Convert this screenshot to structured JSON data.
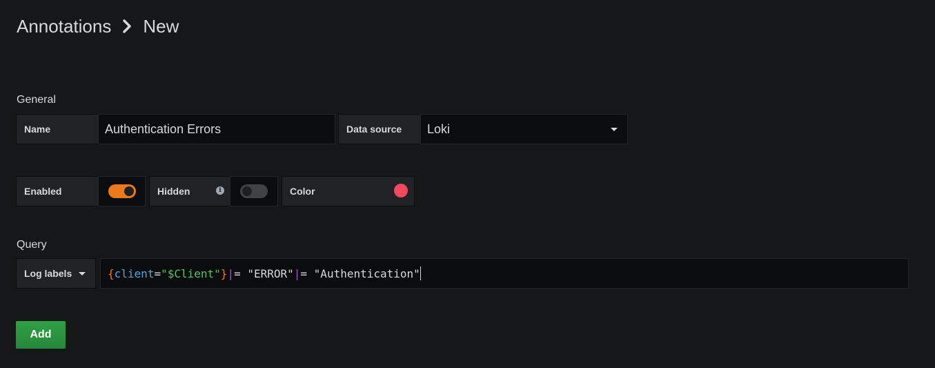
{
  "breadcrumb": {
    "parent": "Annotations",
    "current": "New"
  },
  "general": {
    "section_label": "General",
    "name_label": "Name",
    "name_value": "Authentication Errors",
    "datasource_label": "Data source",
    "datasource_value": "Loki"
  },
  "toggles": {
    "enabled_label": "Enabled",
    "enabled": true,
    "hidden_label": "Hidden",
    "hidden": false,
    "color_label": "Color",
    "color_value": "#f2495c"
  },
  "query": {
    "section_label": "Query",
    "mode_label": "Log labels",
    "tokens": {
      "open_brace": "{",
      "label_key": "client",
      "equals": "=",
      "label_value": "\"$Client\"",
      "close_brace": "}",
      "pipe1": "|",
      "op1": "= ",
      "str1": "\"ERROR\"",
      "pipe2": "|",
      "op2": "= ",
      "str2": "\"Authentication\""
    }
  },
  "actions": {
    "add_label": "Add"
  },
  "colors": {
    "accent_orange": "#eb7b18",
    "success_green": "#2ea043",
    "background": "#161719"
  },
  "icons": {
    "breadcrumb_separator": "chevron-right-icon",
    "datasource_dropdown": "caret-down-icon",
    "hidden_info": "info-circle-icon",
    "query_mode_dropdown": "caret-down-icon"
  }
}
